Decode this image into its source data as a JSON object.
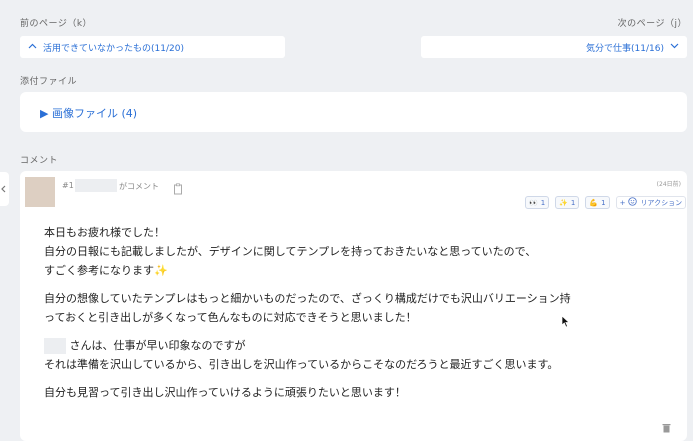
{
  "nav": {
    "prev_label": "前のページ（k）",
    "next_label": "次のページ（j）",
    "prev_title": "活用できていなかったもの(11/20)",
    "next_title": "気分で仕事(11/16)"
  },
  "attachments": {
    "section_label": "添付ファイル",
    "toggle_label": "▶ 画像ファイル (4)"
  },
  "comments": {
    "section_label": "コメント",
    "items": [
      {
        "number": "#1",
        "action_text": "がコメント",
        "time": "(24日前)",
        "reactions": [
          {
            "icon": "eyes-icon",
            "glyph": "👀",
            "count": "1"
          },
          {
            "icon": "sparkles-icon",
            "glyph": "✨",
            "count": "1"
          },
          {
            "icon": "muscle-icon",
            "glyph": "💪",
            "count": "1"
          }
        ],
        "reaction_button_label": "リアクション",
        "paragraphs": [
          [
            "本日もお疲れ様でした！",
            "自分の日報にも記載しましたが、デザインに関してテンプレを持っておきたいなと思っていたので、",
            "すごく参考になります✨"
          ],
          [
            "自分の想像していたテンプレはもっと細かいものだったので、ざっくり構成だけでも沢山バリエーション持",
            "っておくと引き出しが多くなって色んなものに対応できそうと思いました！"
          ],
          [
            "さんは、仕事が早い印象なのですが",
            "それは準備を沢山しているから、引き出しを沢山作っているからこそなのだろうと最近すごく思います。"
          ],
          [
            "自分も見習って引き出し沢山作っていけるように頑張りたいと思います！"
          ]
        ]
      }
    ]
  }
}
